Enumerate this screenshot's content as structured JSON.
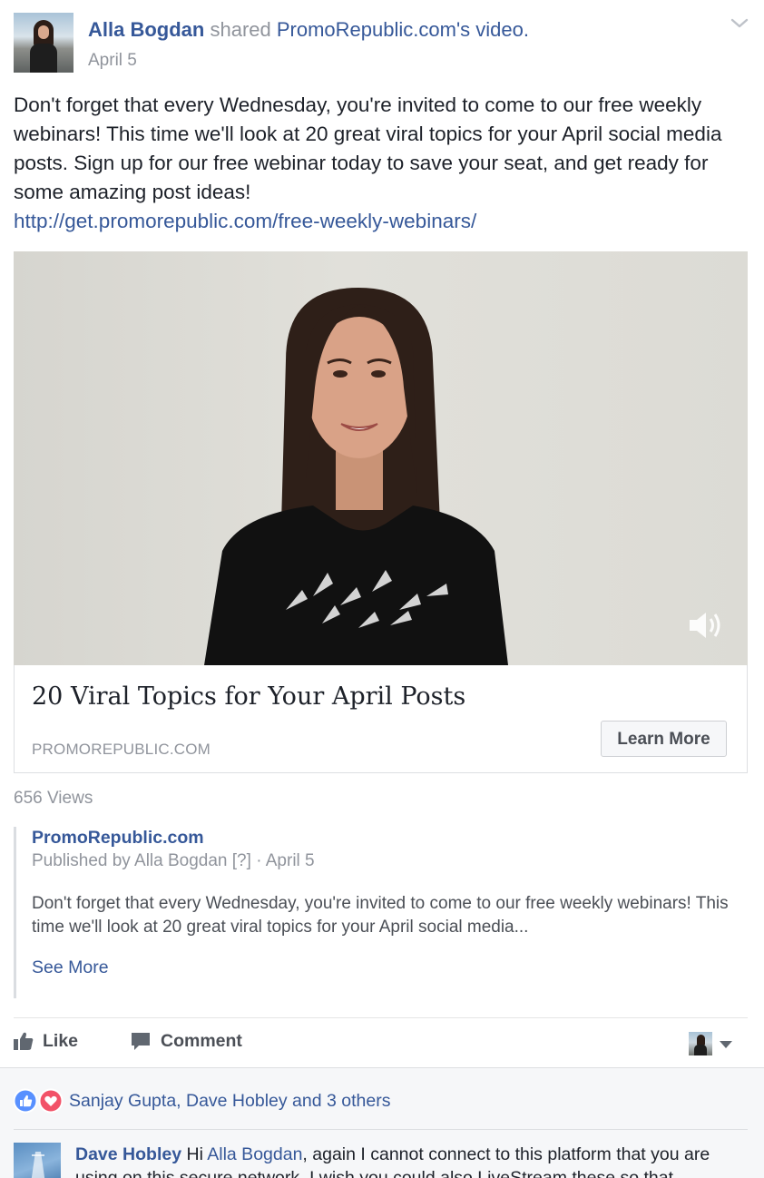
{
  "header": {
    "author": "Alla Bogdan",
    "action_text": "shared",
    "shared_source": "PromoRepublic.com",
    "suffix": "'s video.",
    "date": "April 5",
    "menu_icon": "chevron-down-icon"
  },
  "post": {
    "text": "Don't forget that every Wednesday, you're invited to come to our free weekly webinars! This time we'll look at 20 great viral topics for your April social media posts. Sign up for our free webinar today to save your seat, and get ready for some amazing post ideas!",
    "url": "http://get.promorepublic.com/free-weekly-webinars/"
  },
  "video": {
    "volume_icon": "volume-icon"
  },
  "card": {
    "title": "20 Viral Topics for Your April Posts",
    "domain": "PROMOREPUBLIC.COM",
    "cta_label": "Learn More"
  },
  "views": "656 Views",
  "original_post": {
    "page": "PromoRepublic.com",
    "published_prefix": "Published by Alla Bogdan",
    "help_marker": "[?]",
    "separator": "·",
    "date": "April 5",
    "text": "Don't forget that every Wednesday, you're invited to come to our free weekly webinars! This time we'll look at 20 great viral topics for your April social media...",
    "see_more": "See More"
  },
  "actions": {
    "like_label": "Like",
    "comment_label": "Comment"
  },
  "reactions": {
    "summary": "Sanjay Gupta, Dave Hobley and 3 others",
    "types": [
      "like",
      "love"
    ]
  },
  "comment": {
    "author": "Dave Hobley",
    "text_before": " Hi ",
    "mention": "Alla Bogdan",
    "text_after": ", again I cannot connect to this platform that you are using on this secure network. I wish you could also LiveStream these so that"
  },
  "colors": {
    "link": "#365899",
    "secondary_text": "#90949c",
    "primary_text": "#1d2129",
    "like_blue": "#5890ff",
    "love_red": "#f25268"
  }
}
